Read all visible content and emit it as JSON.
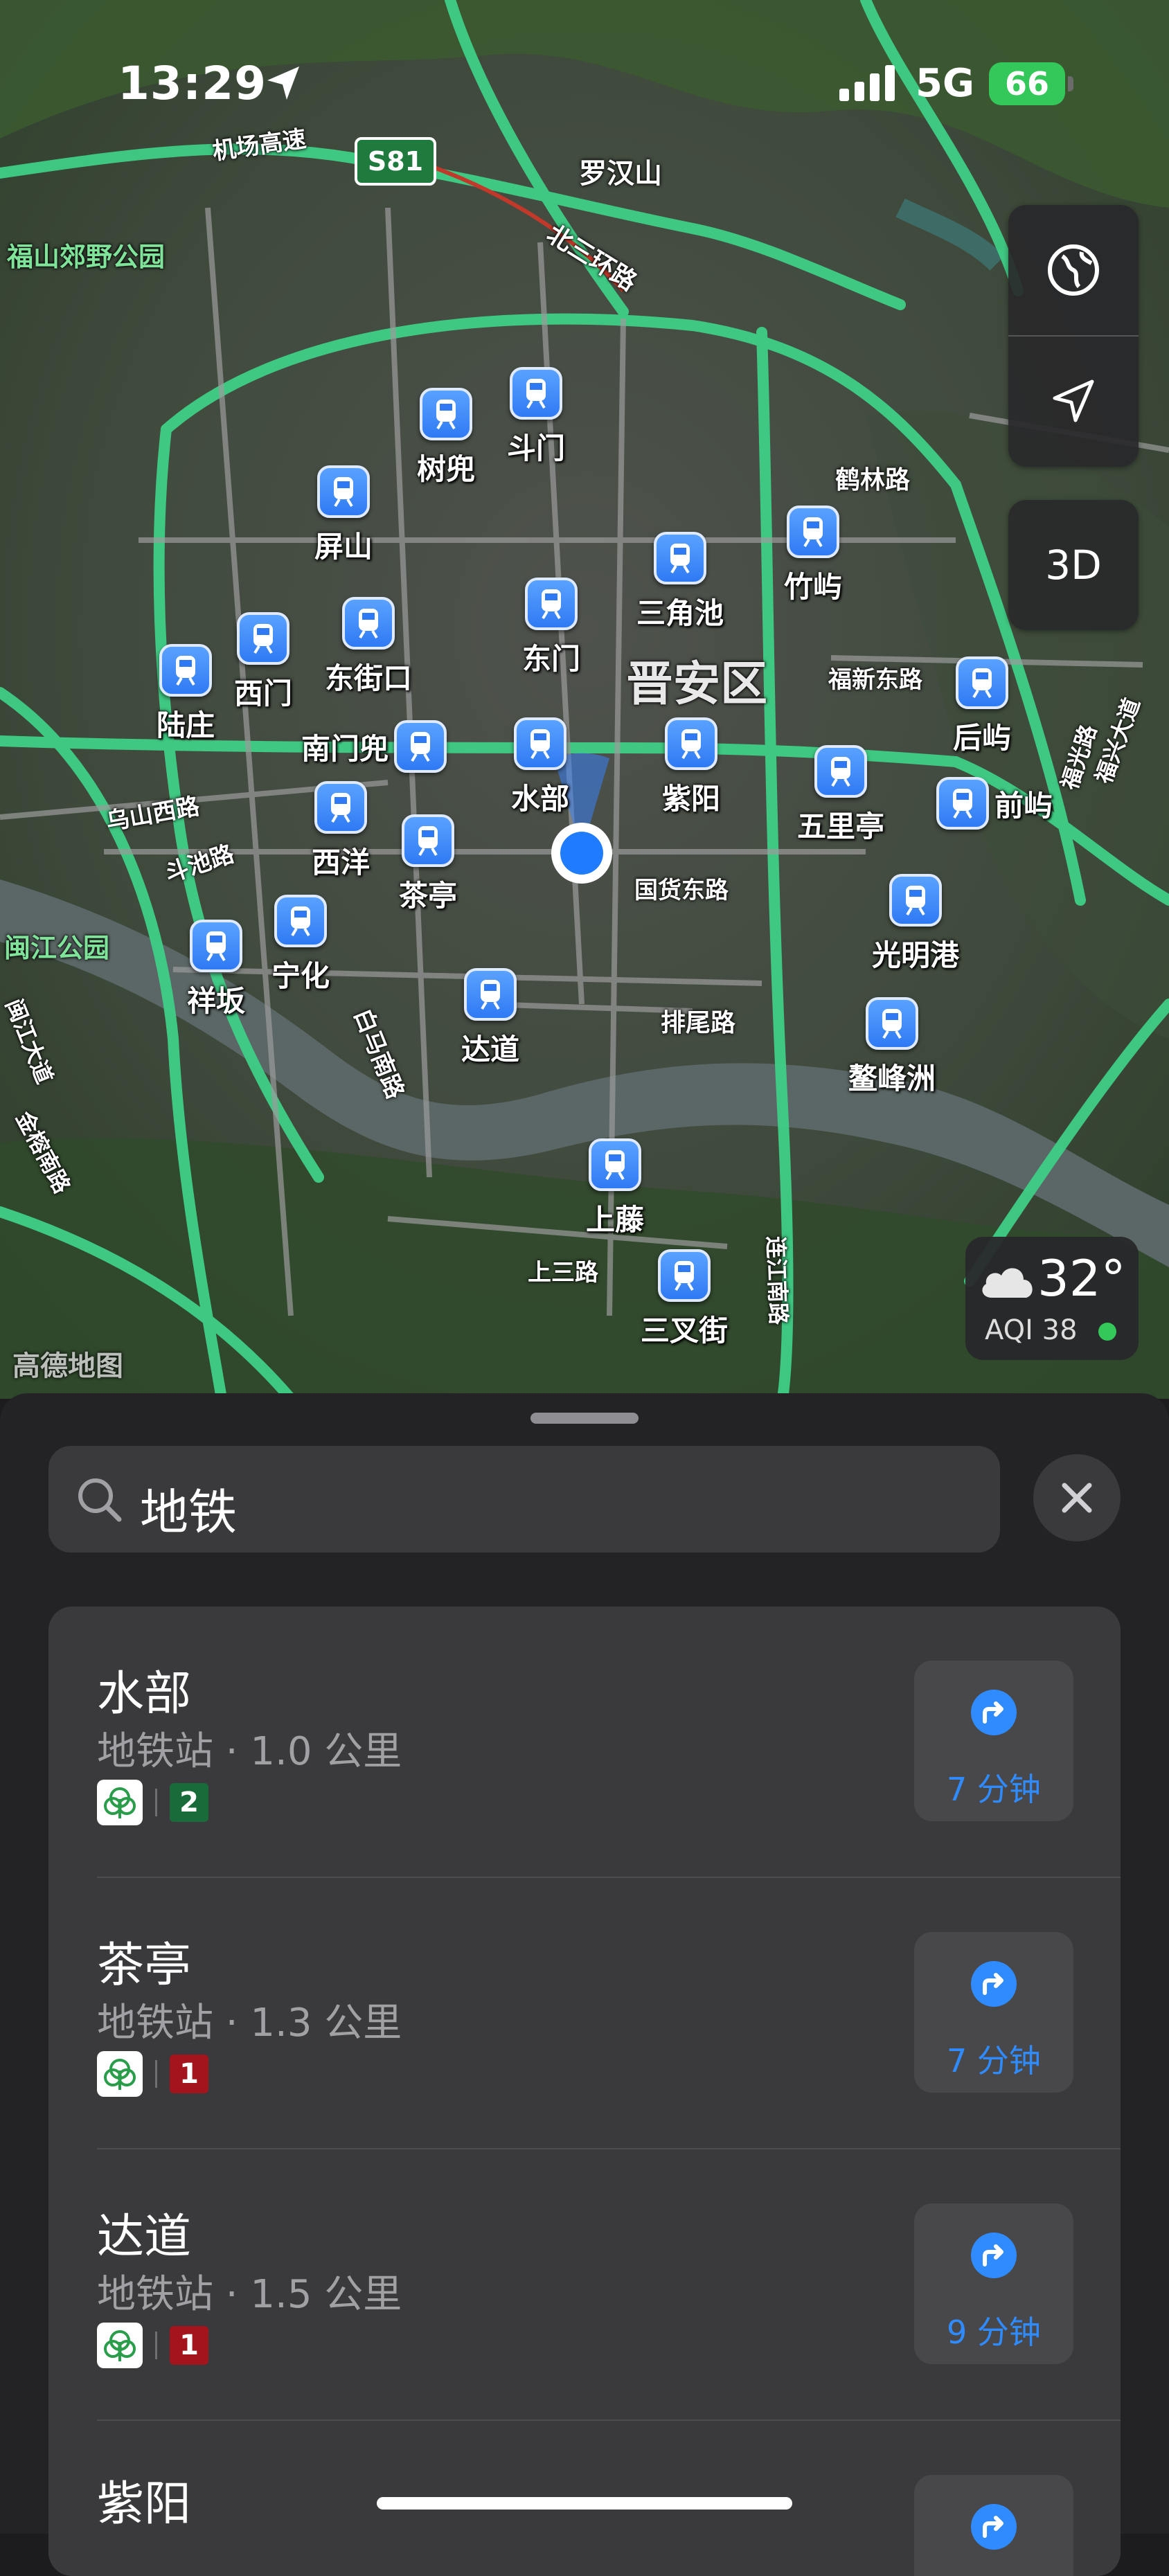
{
  "status_bar": {
    "time": "13:29",
    "network": "5G",
    "battery": "66"
  },
  "map": {
    "highway_shield": "S81",
    "district_label": "晋安区",
    "place_labels": [
      "罗汉山",
      "福山郊野公园",
      "闽江公园",
      "机场高速",
      "北三环路",
      "鹤林路",
      "福新东路",
      "国货东路",
      "排尾路",
      "乌山西路",
      "斗池路",
      "白马南路",
      "上三路",
      "福兴大道",
      "福光路",
      "金榕南路",
      "连江南路",
      "闽江大道"
    ],
    "map_credit": "高德地图",
    "stations": [
      "树兜",
      "斗门",
      "屏山",
      "三角池",
      "竹屿",
      "西门",
      "东街口",
      "东门",
      "陆庄",
      "南门兜",
      "水部",
      "紫阳",
      "五里亭",
      "后屿",
      "前屿",
      "西洋",
      "茶亭",
      "光明港",
      "祥坂",
      "宁化",
      "达道",
      "鳌峰洲",
      "上藤",
      "三叉街"
    ]
  },
  "controls": {
    "view_3d": "3D"
  },
  "weather": {
    "temperature": "32°",
    "aqi": "AQI 38"
  },
  "search": {
    "query": "地铁"
  },
  "results": [
    {
      "name": "水部",
      "subtitle": "地铁站 · 1.0 公里",
      "line": "2",
      "line_color": "#1a6b3a",
      "eta": "7 分钟"
    },
    {
      "name": "茶亭",
      "subtitle": "地铁站 · 1.3 公里",
      "line": "1",
      "line_color": "#a3141c",
      "eta": "7 分钟"
    },
    {
      "name": "达道",
      "subtitle": "地铁站 · 1.5 公里",
      "line": "1",
      "line_color": "#a3141c",
      "eta": "9 分钟"
    },
    {
      "name": "紫阳",
      "subtitle": "",
      "line": "",
      "line_color": "",
      "eta": ""
    }
  ],
  "colors": {
    "accent": "#2f8bff",
    "road": "#3fcf86",
    "battery": "#34c759"
  }
}
